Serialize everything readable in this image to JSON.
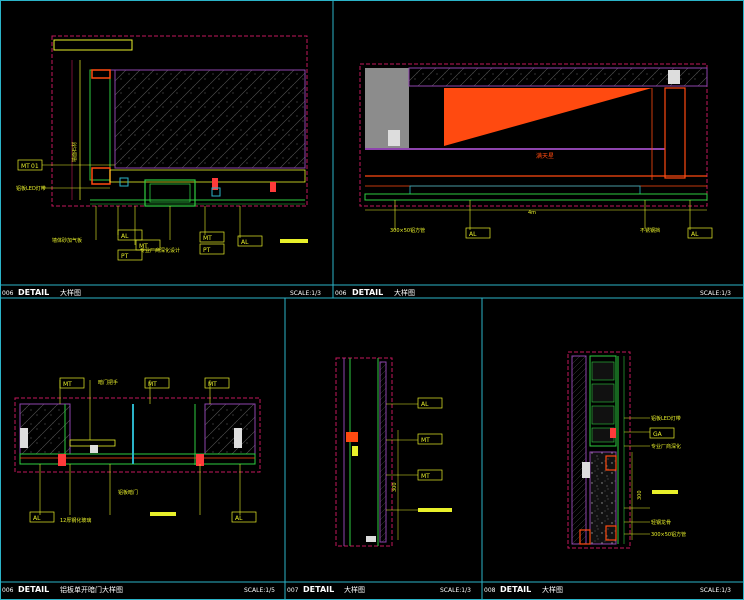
{
  "colors": {
    "background": "#000000",
    "frame": "#2bb3c8",
    "wall_outline": "#c2185b",
    "section_line": "#8e44ad",
    "structure": "#ff3a3a",
    "trim": "#e8f02a",
    "orange_panel": "#ff4a10",
    "grey_panel": "#8c8c8c",
    "green_line": "#2ecc40",
    "title_text": "#ffffff",
    "scale_text": "#ffffff",
    "annotation_text": "#e8f02a"
  },
  "panels": [
    {
      "id": "006",
      "title": "DETAIL",
      "subtitle": "大样图",
      "scale": "SCALE:1/3"
    },
    {
      "id": "006",
      "title": "DETAIL",
      "subtitle": "大样图",
      "scale": "SCALE:1/3"
    },
    {
      "id": "006",
      "title": "DETAIL",
      "subtitle": "铝板单开暗门大样图",
      "scale": "SCALE:1/5"
    },
    {
      "id": "007",
      "title": "DETAIL",
      "subtitle": "大样图",
      "scale": "SCALE:1/3"
    },
    {
      "id": "008",
      "title": "DETAIL",
      "subtitle": "大样图",
      "scale": "SCALE:1/3"
    }
  ],
  "tags": {
    "al": "AL",
    "ga": "GA",
    "mt": "MT",
    "pt": "PT",
    "num01": "01",
    "num04": "04"
  },
  "annotations": {
    "p1_left_vertical": "墙面石材",
    "p1_side_note": "铝板LED灯带",
    "p1_bottom_note": "墙体砂加气板",
    "p1_center_note": "专业厂商深化设计",
    "p2_center_label": "满天星",
    "p2_left_note": "300×50铝方管",
    "p2_right_note": "不锈钢挡",
    "p2_dimension": "4m",
    "p3_top_note": "暗门把手",
    "p3_center_dim": "铝板暗门",
    "p3_bottom_note": "12厚钢化玻璃",
    "p4_dim": "300",
    "p5_note_1": "铝板LED灯带",
    "p5_note_2": "专业厂商深化",
    "p5_note_3": "轻钢龙骨",
    "p5_note_4": "300×50铝方管",
    "p5_dim": "300"
  }
}
